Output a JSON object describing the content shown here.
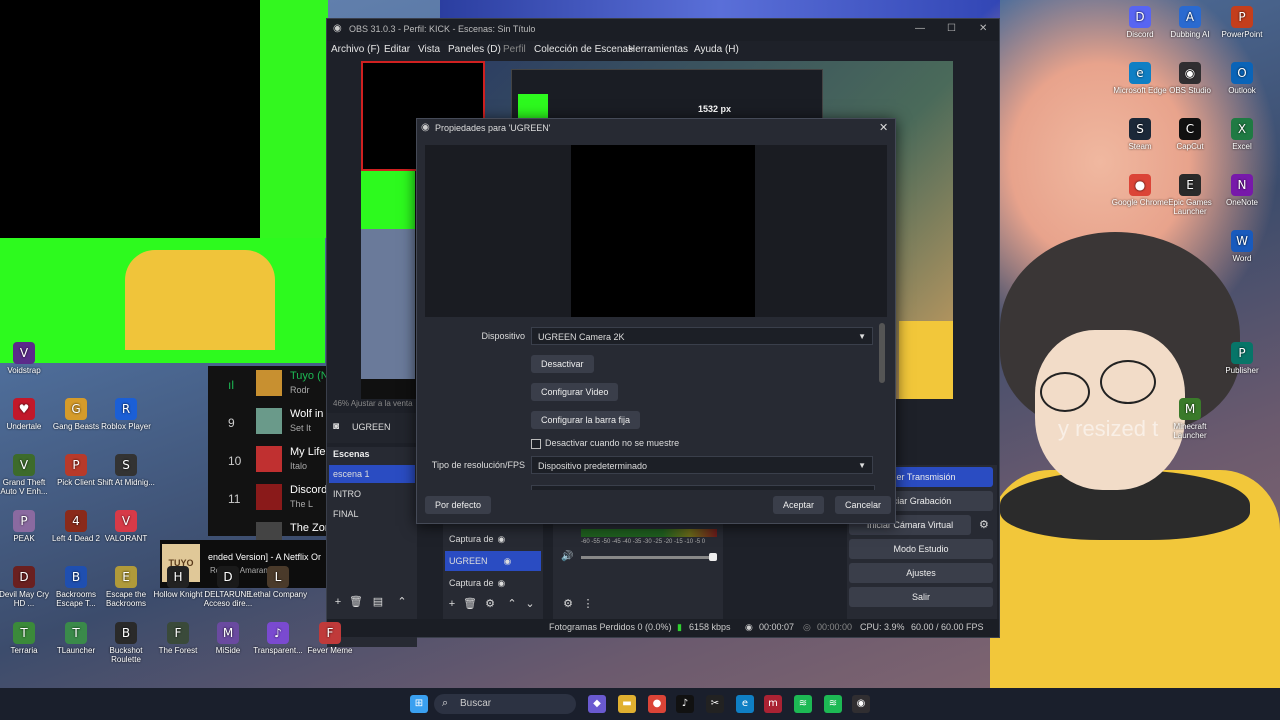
{
  "desktop": {
    "left_icons": [
      {
        "label": "Voidstrap",
        "glyph": "V",
        "color": "#5b2a8a"
      },
      {
        "label": "Undertale",
        "glyph": "♥",
        "color": "#c2182a"
      },
      {
        "label": "Gang Beasts",
        "glyph": "G",
        "color": "#d59b2a"
      },
      {
        "label": "Roblox Player",
        "glyph": "R",
        "color": "#1b5fd6"
      },
      {
        "label": "Grand Theft Auto V Enh...",
        "glyph": "V",
        "color": "#3d6b2b"
      },
      {
        "label": "Pick Client",
        "glyph": "P",
        "color": "#b83a2a"
      },
      {
        "label": "Shift At Midnig...",
        "glyph": "S",
        "color": "#333333"
      },
      {
        "label": "PEAK",
        "glyph": "P",
        "color": "#8a6aa0"
      },
      {
        "label": "Left 4 Dead 2",
        "glyph": "4",
        "color": "#8a2a1a"
      },
      {
        "label": "VALORANT",
        "glyph": "V",
        "color": "#d73a48"
      },
      {
        "label": "Devil May Cry HD ...",
        "glyph": "D",
        "color": "#6a2020"
      },
      {
        "label": "Backrooms Escape T...",
        "glyph": "B",
        "color": "#1f4fb0"
      },
      {
        "label": "Escape the Backrooms",
        "glyph": "E",
        "color": "#b09a3a"
      },
      {
        "label": "Hollow Knight",
        "glyph": "H",
        "color": "#222222"
      },
      {
        "label": "DELTARUNE Acceso dire...",
        "glyph": "D",
        "color": "#1a1a1a"
      },
      {
        "label": "Lethal Company",
        "glyph": "L",
        "color": "#4a3a2a"
      },
      {
        "label": "Terraria",
        "glyph": "T",
        "color": "#3b8a3a"
      },
      {
        "label": "TLauncher",
        "glyph": "T",
        "color": "#3a8a4a"
      },
      {
        "label": "Buckshot Roulette",
        "glyph": "B",
        "color": "#2a2a2a"
      },
      {
        "label": "The Forest",
        "glyph": "F",
        "color": "#3a4a3a"
      },
      {
        "label": "MiSide",
        "glyph": "M",
        "color": "#6a4aa0"
      },
      {
        "label": "Transparent...",
        "glyph": "♪",
        "color": "#7a4ad0"
      },
      {
        "label": "Fever Meme",
        "glyph": "F",
        "color": "#c03a3a"
      }
    ],
    "right_icons": [
      {
        "label": "Discord",
        "glyph": "D",
        "color": "#5865f2"
      },
      {
        "label": "Dubbing AI",
        "glyph": "A",
        "color": "#2a6ad0"
      },
      {
        "label": "PowerPoint",
        "glyph": "P",
        "color": "#c43e1c"
      },
      {
        "label": "Microsoft Edge",
        "glyph": "e",
        "color": "#0f7fc4"
      },
      {
        "label": "OBS Studio",
        "glyph": "◉",
        "color": "#302e31"
      },
      {
        "label": "Outlook",
        "glyph": "O",
        "color": "#0a64b8"
      },
      {
        "label": "Steam",
        "glyph": "S",
        "color": "#1b2838"
      },
      {
        "label": "CapCut",
        "glyph": "C",
        "color": "#111111"
      },
      {
        "label": "Excel",
        "glyph": "X",
        "color": "#1f7a43"
      },
      {
        "label": "Google Chrome",
        "glyph": "●",
        "color": "#db4437"
      },
      {
        "label": "Epic Games Launcher",
        "glyph": "E",
        "color": "#2a2a2a"
      },
      {
        "label": "OneNote",
        "glyph": "N",
        "color": "#7719aa"
      },
      {
        "label": "Word",
        "glyph": "W",
        "color": "#185abd"
      },
      {
        "label": "Publisher",
        "glyph": "P",
        "color": "#077568"
      },
      {
        "label": "Minecraft Launcher",
        "glyph": "M",
        "color": "#3a7a2a"
      }
    ],
    "overlay_text": "y resized t"
  },
  "spotify": {
    "rows": [
      {
        "num": "",
        "title": "Tuyo (N",
        "sub": "Rodr"
      },
      {
        "num": "9",
        "title": "Wolf in",
        "sub": "Set It"
      },
      {
        "num": "10",
        "title": "My Life",
        "sub": "Italo"
      },
      {
        "num": "11",
        "title": "Discord",
        "sub": "The L"
      },
      {
        "num": "",
        "title": "The Zon",
        "sub": ""
      }
    ],
    "now_playing": {
      "title": "ended Version] - A Netflix Or",
      "artist": "Rodrigo Amarante",
      "art_text": "TUYO"
    }
  },
  "obs": {
    "title": "OBS 31.0.3 - Perfil: KICK - Escenas: Sin Título",
    "menu": [
      "Archivo (F)",
      "Editar",
      "Vista",
      "Paneles (D)",
      "Perfil",
      "Colección de Escenas",
      "Herramientas",
      "Ayuda (H)"
    ],
    "preview_status": "46%   Ajustar a la venta",
    "nested_preview_label": "1532 px",
    "scenes_title": "Escenas",
    "scenes": [
      "escena 1",
      "INTRO",
      "FINAL"
    ],
    "selected_source": "UGREEN",
    "sources": [
      "Captura de",
      "UGREEN",
      "Captura de"
    ],
    "mixer_scale": "-60 -55 -50 -45 -40 -35 -30 -25 -20 -15 -10 -5 0",
    "controls": [
      "ener Transmisión",
      "iciar Grabación",
      "Iniciar Cámara Virtual",
      "Modo Estudio",
      "Ajustes",
      "Salir"
    ],
    "status": {
      "dropped": "Fotogramas Perdidos 0 (0.0%)",
      "bitrate": "6158 kbps",
      "rec_time": "00:00:07",
      "stream_time": "00:00:00",
      "cpu": "CPU: 3.9%",
      "fps": "60.00 / 60.00 FPS"
    }
  },
  "props": {
    "title": "Propiedades para 'UGREEN'",
    "device_label": "Dispositivo",
    "device_value": "UGREEN Camera 2K",
    "btn_deactivate": "Desactivar",
    "btn_config_video": "Configurar Video",
    "btn_config_bar": "Configurar la barra fija",
    "checkbox_label": "Desactivar cuando no se muestre",
    "res_label": "Tipo de resolución/FPS",
    "res_value": "Dispositivo predeterminado",
    "btn_default": "Por defecto",
    "btn_ok": "Aceptar",
    "btn_cancel": "Cancelar"
  },
  "taskbar": {
    "search_placeholder": "Buscar",
    "apps": [
      {
        "name": "start-icon",
        "glyph": "⊞",
        "color": "#3aa0f0"
      },
      {
        "name": "copilot-icon",
        "glyph": "◆",
        "color": "#6a5ad0"
      },
      {
        "name": "file-explorer-icon",
        "glyph": "▬",
        "color": "#e0b030"
      },
      {
        "name": "chrome-icon",
        "glyph": "●",
        "color": "#db4437"
      },
      {
        "name": "tiktok-icon",
        "glyph": "♪",
        "color": "#111111"
      },
      {
        "name": "capcut-icon",
        "glyph": "✂",
        "color": "#222222"
      },
      {
        "name": "edge-icon",
        "glyph": "e",
        "color": "#0f7fc4"
      },
      {
        "name": "app-m-icon",
        "glyph": "m",
        "color": "#aa2233"
      },
      {
        "name": "spotify-icon",
        "glyph": "≋",
        "color": "#1db954"
      },
      {
        "name": "spotify2-icon",
        "glyph": "≋",
        "color": "#1db954"
      },
      {
        "name": "obs-icon",
        "glyph": "◉",
        "color": "#302e31"
      }
    ]
  }
}
